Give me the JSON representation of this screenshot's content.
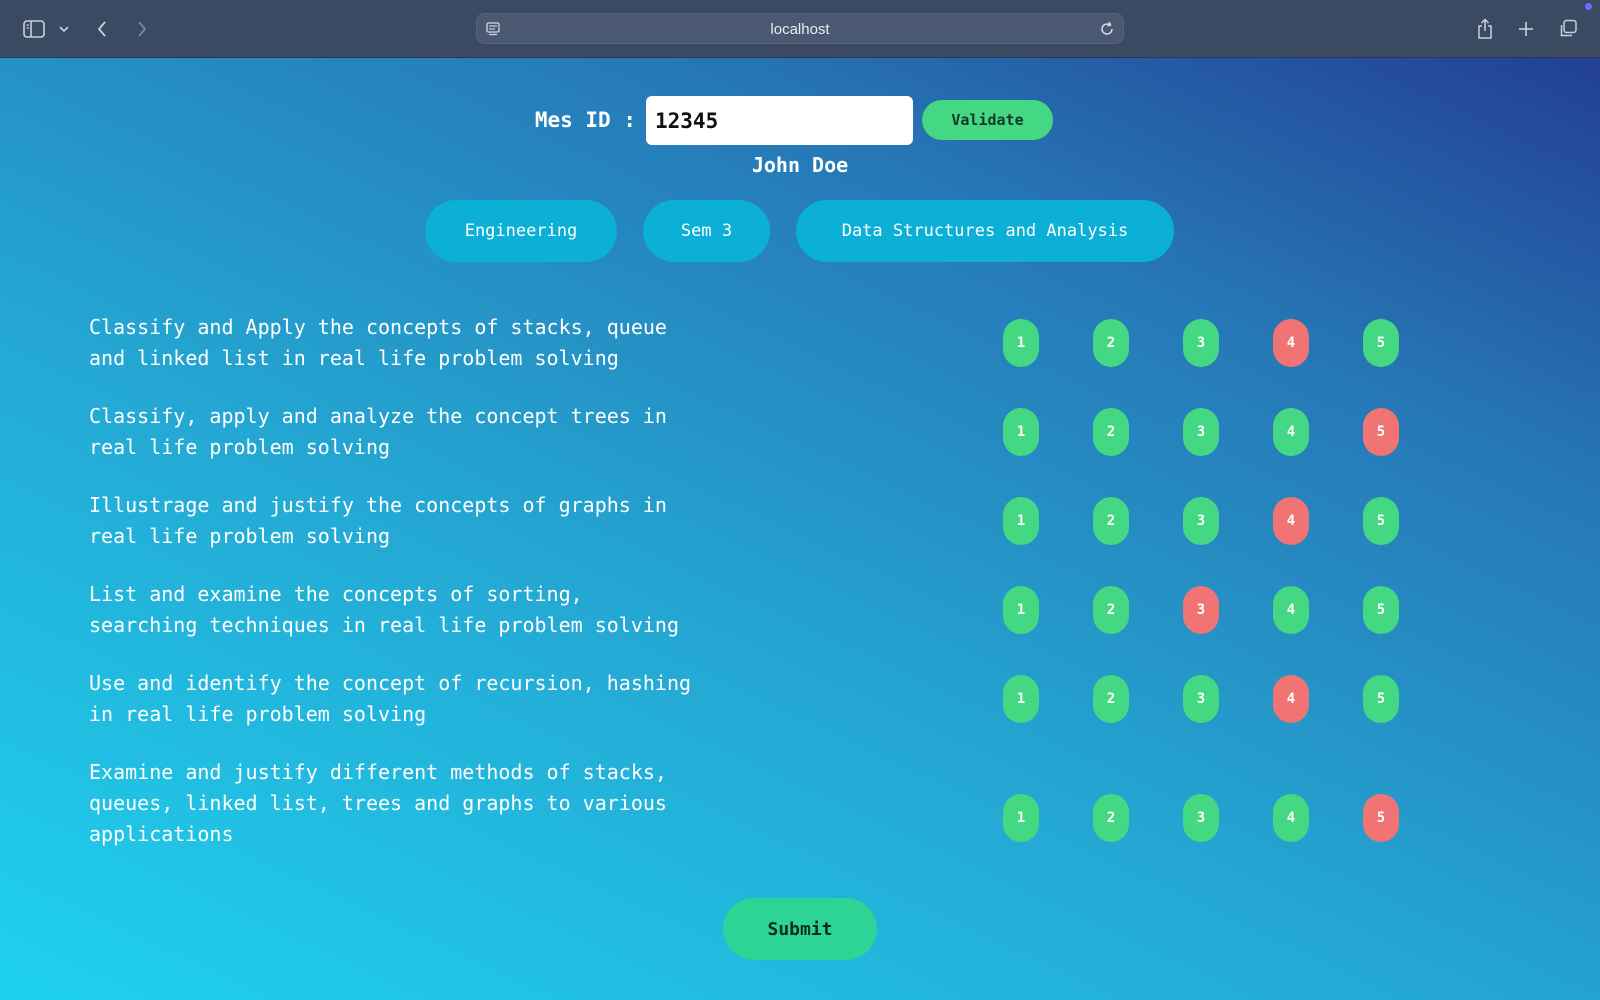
{
  "browser": {
    "url": "localhost"
  },
  "form": {
    "id_label": "Mes ID :",
    "id_value": "12345",
    "validate_label": "Validate",
    "user_name": "John Doe"
  },
  "tags": [
    "Engineering",
    "Sem 3",
    "Data Structures and Analysis"
  ],
  "questions": [
    {
      "lines": [
        "Classify and Apply the concepts of stacks, queue",
        "and linked list in real life problem solving"
      ],
      "selected": 4
    },
    {
      "lines": [
        "Classify, apply and analyze the concept trees in",
        "real life problem solving"
      ],
      "selected": 5
    },
    {
      "lines": [
        "Illustrage and justify the concepts of graphs in",
        "real life problem solving"
      ],
      "selected": 4
    },
    {
      "lines": [
        "List and examine the concepts of sorting,",
        "searching techniques in real life problem solving"
      ],
      "selected": 3
    },
    {
      "lines": [
        "Use and identify the concept of recursion, hashing",
        "in real life problem solving"
      ],
      "selected": 4
    },
    {
      "lines": [
        "Examine and justify different methods of stacks,",
        "queues, linked list, trees and graphs to various",
        "applications"
      ],
      "selected": 5
    }
  ],
  "rating_options": [
    "1",
    "2",
    "3",
    "4",
    "5"
  ],
  "colors": {
    "option_default": "#45d882",
    "option_selected": "#f07474",
    "tag_bg": "#0cb0d6",
    "accent": "#45d882"
  },
  "submit_label": "Submit"
}
